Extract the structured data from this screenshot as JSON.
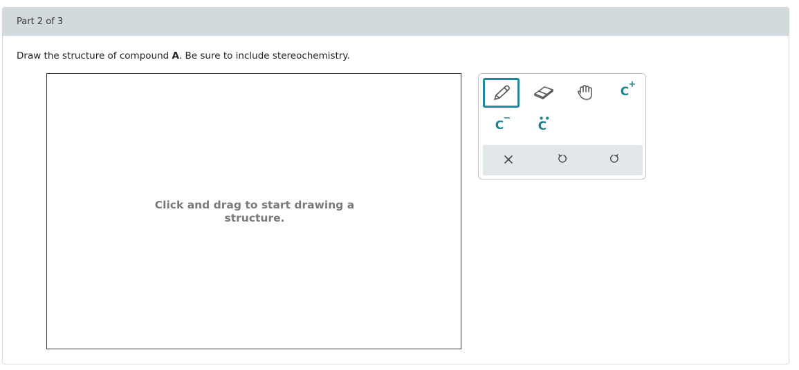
{
  "header": {
    "part_label": "Part 2 of 3"
  },
  "instructions": {
    "before": "Draw the structure of compound ",
    "compound": "A",
    "after": ". Be sure to include stereochemistry."
  },
  "canvas": {
    "hint_line1": "Click and drag to start drawing a",
    "hint_line2": "structure."
  },
  "toolbar": {
    "tools": [
      {
        "name": "pencil-icon",
        "selected": true
      },
      {
        "name": "eraser-icon",
        "selected": false
      },
      {
        "name": "hand-icon",
        "selected": false
      },
      {
        "name": "carbocation-icon",
        "selected": false
      },
      {
        "name": "carbanion-icon",
        "selected": false
      },
      {
        "name": "carbene-icon",
        "selected": false
      }
    ],
    "carbocation_letter": "C",
    "carbocation_sign": "+",
    "carbanion_letter": "C",
    "carbanion_sign": "−",
    "carbene_letter": "C",
    "carbene_dots": "••",
    "actions": [
      "clear-icon",
      "undo-icon",
      "redo-icon"
    ]
  },
  "colors": {
    "accent": "#1e8a9c",
    "header_bg": "#d3dadd",
    "action_bar_bg": "#e2e7ea",
    "hint_text": "#7a7a7a"
  }
}
